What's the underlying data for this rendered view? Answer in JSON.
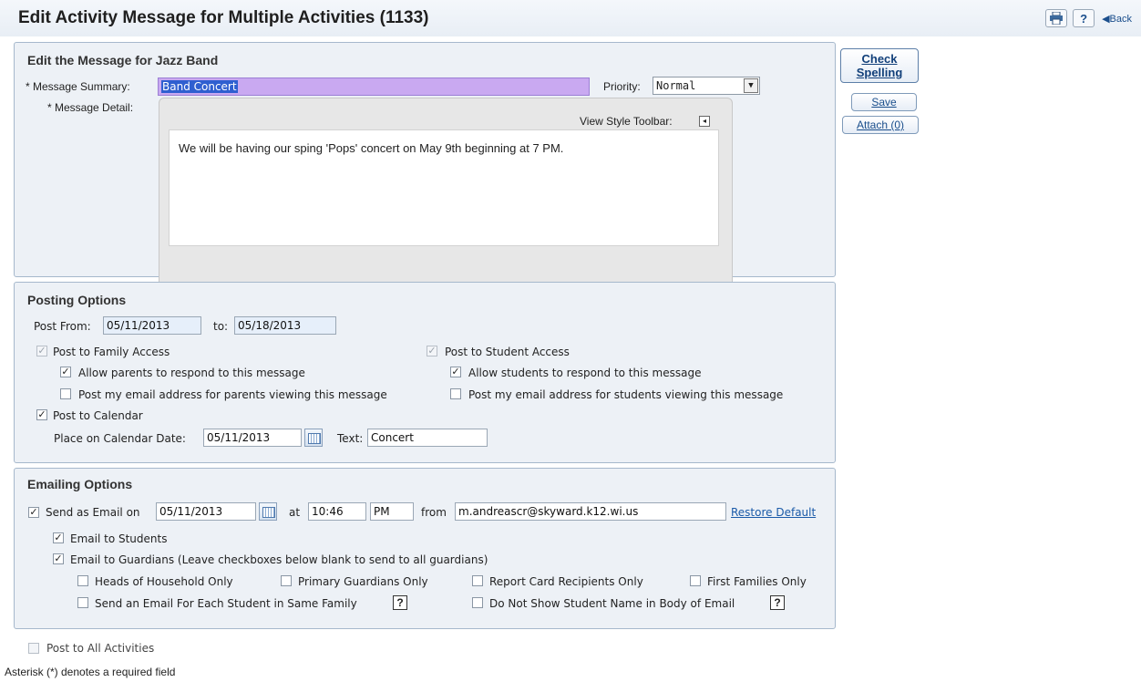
{
  "header": {
    "title": "Edit Activity Message for Multiple Activities (1133)",
    "print_icon": "printer-icon",
    "help_label": "?",
    "back_label": "◀Back"
  },
  "actions": {
    "check_spelling": "Check Spelling",
    "save": "Save",
    "attach": "Attach (0)"
  },
  "message": {
    "section_title": "Edit the Message for Jazz Band",
    "summary_label": "* Message Summary:",
    "summary_value": "Band Concert",
    "priority_label": "Priority:",
    "priority_value": "Normal",
    "detail_label": "* Message Detail:",
    "toolbar_label": "View Style Toolbar:",
    "detail_text": "We will be having our sping 'Pops' concert on May 9th beginning at 7 PM."
  },
  "posting": {
    "section_title": "Posting Options",
    "post_from_label": "Post From:",
    "post_from": "05/11/2013",
    "to_label": "to:",
    "post_to": "05/18/2013",
    "family_access": "Post to Family Access",
    "allow_parents": "Allow parents to respond to this message",
    "post_email_parents": "Post my email address for parents viewing this message",
    "student_access": "Post to Student Access",
    "allow_students": "Allow students to respond to this message",
    "post_email_students": "Post my email address for students viewing this message",
    "post_calendar": "Post to Calendar",
    "calendar_date_label": "Place on Calendar Date:",
    "calendar_date": "05/11/2013",
    "text_label": "Text:",
    "text_value": "Concert",
    "checks": {
      "family_access": true,
      "allow_parents": true,
      "post_email_parents": false,
      "student_access": true,
      "allow_students": true,
      "post_email_students": false,
      "post_calendar": true
    }
  },
  "emailing": {
    "section_title": "Emailing Options",
    "send_email_label": "Send as Email on",
    "send_date": "05/11/2013",
    "at_label": "at",
    "time": "10:46",
    "ampm": "PM",
    "from_label": "from",
    "from_email": "m.andreascr@skyward.k12.wi.us",
    "restore_default": "Restore Default",
    "email_students": "Email to Students",
    "email_guardians": "Email to Guardians (Leave checkboxes below blank to send to all guardians)",
    "heads_household": "Heads of Household Only",
    "primary_guardians": "Primary Guardians Only",
    "report_card": "Report Card Recipients Only",
    "first_families": "First Families Only",
    "each_student": "Send an Email For Each Student in Same Family",
    "no_student_name": "Do Not Show Student Name in Body of Email",
    "help_label": "?",
    "checks": {
      "send_email": true,
      "email_students": true,
      "email_guardians": true,
      "heads_household": false,
      "primary_guardians": false,
      "report_card": false,
      "first_families": false,
      "each_student": false,
      "no_student_name": false
    }
  },
  "footer": {
    "post_all_activities": "Post to All Activities",
    "post_all_checked": false,
    "required_note": "Asterisk (*) denotes a required field"
  },
  "glyphs": {
    "check": "✓",
    "left_arrow": "◂",
    "down_arrow": "▼"
  },
  "colors": {
    "panel_bg": "#edf1f6",
    "panel_border": "#a6b8cc",
    "link": "#1a5aa8",
    "highlight": "#c9a9f1"
  }
}
